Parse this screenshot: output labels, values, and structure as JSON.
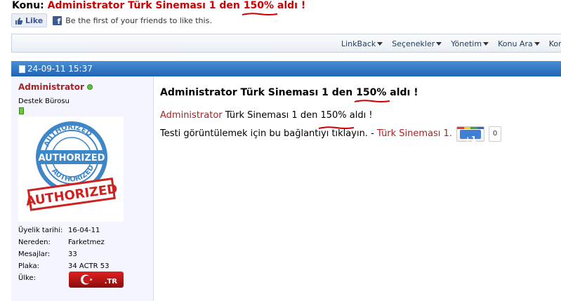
{
  "thread": {
    "konu_label": "Konu:",
    "title_part1": "Administrator Türk Sineması 1 den",
    "title_highlight": "150%",
    "title_part2": "aldı !"
  },
  "facebook": {
    "like_label": "Like",
    "friends_text": "Be the first of your friends to like this."
  },
  "toolbar": {
    "items": [
      "LinkBack",
      "Seçenekler",
      "Yönetim",
      "Konu Ara",
      "Konuyu"
    ]
  },
  "post": {
    "date": "24-09-11 15:37",
    "title_part1": "Administrator Türk Sineması 1 den",
    "title_highlight": "150%",
    "title_part2": "aldı !",
    "body_author_link": "Administrator",
    "body_line1_mid": "Türk Sineması 1 den",
    "body_highlight": "150%",
    "body_line1_end": "aldı !",
    "body_line2_text": "Testi görüntülemek için bu bağlantıyı tıklayın. -",
    "body_line2_link": "Türk Sineması 1.",
    "gplus_label": "+1",
    "gplus_count": "0"
  },
  "user": {
    "name": "Administrator",
    "title": "Destek Bürosu",
    "avatar_text_top": "AUTHORIZED",
    "avatar_text_center": "AUTHORIZED",
    "avatar_text_bottom": "AUTHORIZED",
    "avatar_stamp": "AUTHORIZED",
    "info": [
      {
        "key": "Üyelik tarihi:",
        "value": "16-04-11"
      },
      {
        "key": "Nereden:",
        "value": "Farketmez"
      },
      {
        "key": "Mesajlar:",
        "value": "33"
      },
      {
        "key": "Plaka:",
        "value": "34 ACTR 53"
      },
      {
        "key": "Ülke:",
        "value": ""
      }
    ],
    "flag_text": ".TR"
  },
  "colors": {
    "accent_red": "#cc0000",
    "link_red": "#aa2222",
    "header_blue": "#1f63b4",
    "squiggle": "#cc0000"
  }
}
